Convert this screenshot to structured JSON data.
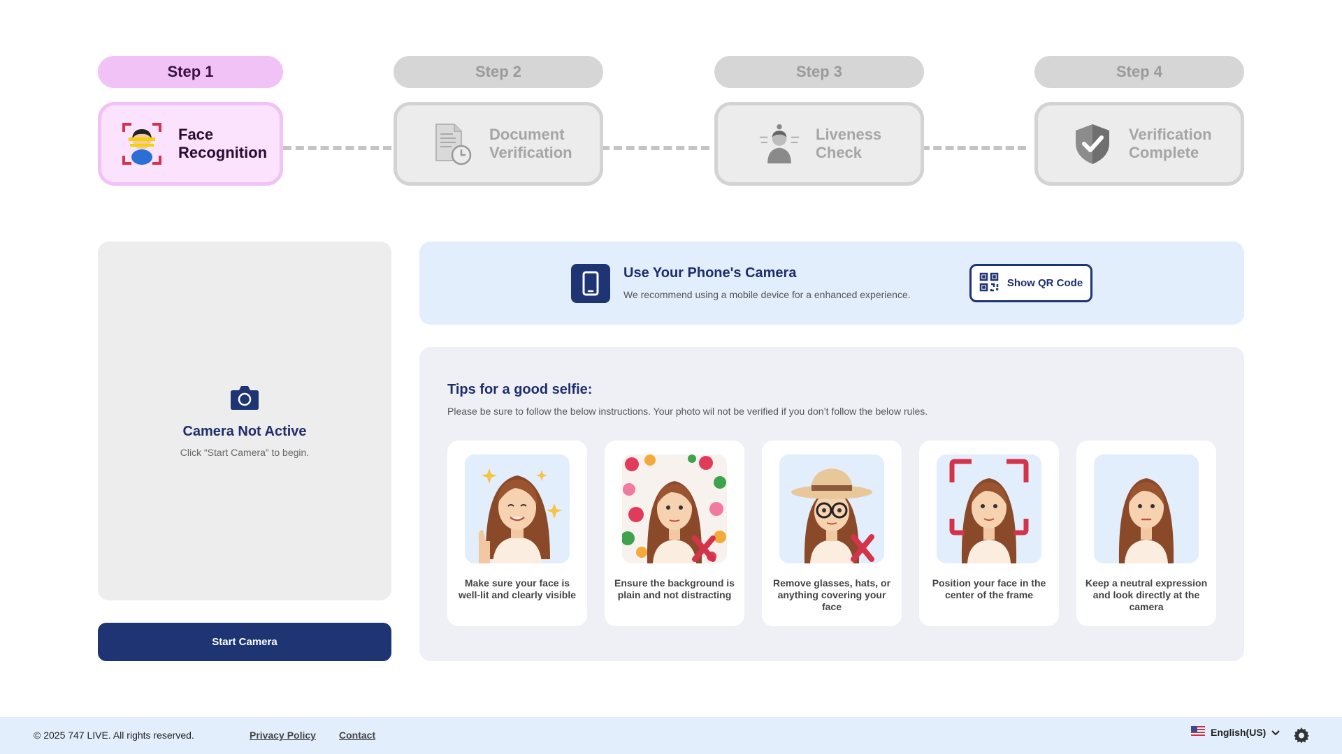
{
  "steps": [
    {
      "pill": "Step 1",
      "label": "Face\nRecognition",
      "icon": "face-scan-icon",
      "active": true
    },
    {
      "pill": "Step 2",
      "label": "Document\nVerification",
      "icon": "document-clock-icon",
      "active": false
    },
    {
      "pill": "Step 3",
      "label": "Liveness\nCheck",
      "icon": "person-motion-icon",
      "active": false
    },
    {
      "pill": "Step 4",
      "label": "Verification\nComplete",
      "icon": "shield-check-icon",
      "active": false
    }
  ],
  "camera": {
    "icon": "camera-icon",
    "title": "Camera Not Active",
    "subtitle": "Click “Start Camera” to begin.",
    "start_label": "Start Camera"
  },
  "phone": {
    "icon": "smartphone-icon",
    "title": "Use Your Phone's Camera",
    "subtitle": "We recommend using a mobile device for a enhanced experience.",
    "qr_label": "Show QR Code",
    "qr_icon": "qr-code-icon"
  },
  "tips": {
    "title": "Tips for a good selfie:",
    "subtitle": "Please be sure to follow the below instructions. Your photo wil not be verified if you don’t follow the below rules.",
    "items": [
      {
        "text": "Make sure your face is well-lit and clearly visible",
        "image": "well-lit-selfie"
      },
      {
        "text": "Ensure the background is plain and not distracting",
        "image": "busy-background-selfie"
      },
      {
        "text": "Remove glasses, hats, or anything covering your face",
        "image": "glasses-hat-selfie"
      },
      {
        "text": "Position your face in the center of the frame",
        "image": "centered-frame-selfie"
      },
      {
        "text": "Keep a neutral expression and look directly at the camera",
        "image": "neutral-expression-selfie"
      }
    ]
  },
  "footer": {
    "copyright": "© 2025 747 LIVE. All rights reserved.",
    "privacy": "Privacy Policy",
    "contact": "Contact",
    "language": "English(US)"
  },
  "colors": {
    "primary": "#1e3473",
    "active_step": "#f1c2f6",
    "inactive_step": "#d6d6d6",
    "banner_bg": "#e2eefc",
    "error_red": "#d4344a"
  }
}
